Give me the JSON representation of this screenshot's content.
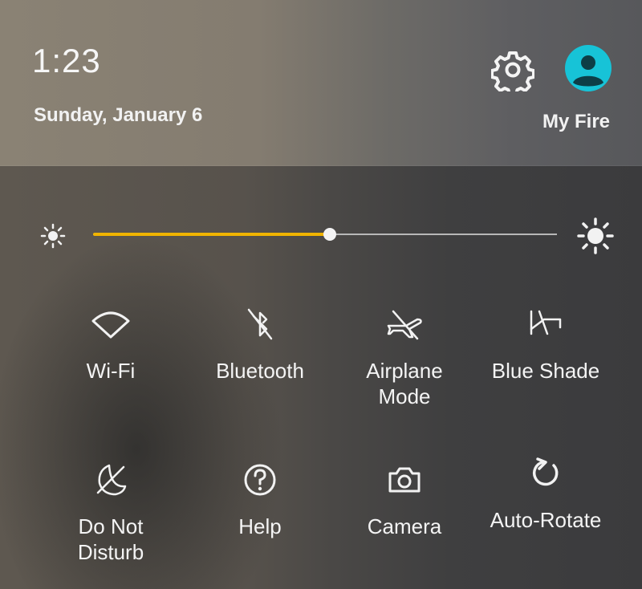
{
  "header": {
    "time": "1:23",
    "date": "Sunday, January 6",
    "profile_label": "My Fire"
  },
  "brightness": {
    "level": 0.51
  },
  "tiles": [
    {
      "label": "Wi-Fi",
      "icon": "wifi-icon"
    },
    {
      "label": "Bluetooth",
      "icon": "bluetooth-off-icon"
    },
    {
      "label": "Airplane\nMode",
      "icon": "airplane-off-icon"
    },
    {
      "label": "Blue Shade",
      "icon": "blue-shade-icon"
    },
    {
      "label": "Do Not\nDisturb",
      "icon": "do-not-disturb-icon"
    },
    {
      "label": "Help",
      "icon": "help-icon"
    },
    {
      "label": "Camera",
      "icon": "camera-icon"
    },
    {
      "label": "Auto-Rotate",
      "icon": "auto-rotate-icon"
    }
  ],
  "colors": {
    "slider_fill": "#f0b400",
    "avatar": "#17c3d7"
  }
}
